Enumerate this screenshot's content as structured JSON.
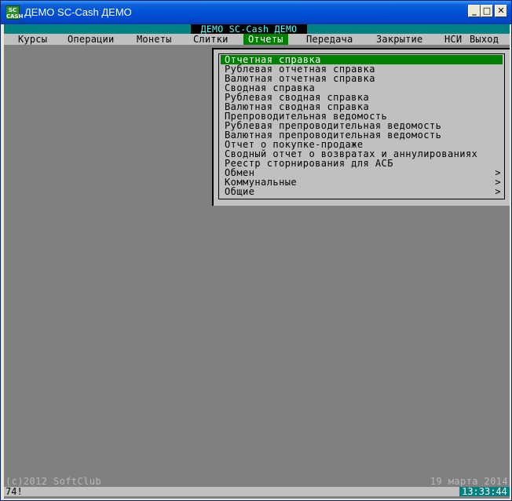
{
  "window": {
    "title": "ДЕМО SC-Cash ДЕМО",
    "icon_text": "SC CASH",
    "controls": {
      "minimize": "_",
      "maximize": "□",
      "close": "✕"
    }
  },
  "terminal": {
    "title": "ДЕМО SC-Cash ДЕМО",
    "menu": [
      {
        "label": "Курсы"
      },
      {
        "label": "Операции"
      },
      {
        "label": "Монеты"
      },
      {
        "label": "Слитки"
      },
      {
        "label": "Отчеты",
        "active": true
      },
      {
        "label": "Передача"
      },
      {
        "label": "Закрытие"
      },
      {
        "label": "НСИ"
      },
      {
        "label": "Выход"
      }
    ],
    "dropdown": [
      {
        "label": "Отчетная справка",
        "selected": true
      },
      {
        "label": "Рублевая отчетная справка"
      },
      {
        "label": "Валютная отчетная справка"
      },
      {
        "label": "Сводная справка"
      },
      {
        "label": "Рублевая сводная справка"
      },
      {
        "label": "Валютная сводная справка"
      },
      {
        "label": "Препроводительная ведомость"
      },
      {
        "label": "Рублевая препроводительная ведомость"
      },
      {
        "label": "Валютная препроводительная ведомость"
      },
      {
        "label": "Отчет о покупке-продаже"
      },
      {
        "label": "Сводный отчет о возвратах и аннулированиях"
      },
      {
        "label": "Реестр сторнирования для АСБ"
      },
      {
        "label": "Обмен",
        "arrow": ">"
      },
      {
        "label": "Коммунальные",
        "arrow": ">"
      },
      {
        "label": "Общие",
        "arrow": ">"
      }
    ],
    "footer": {
      "copyright": "(c)2012 SoftClub",
      "date": "19 марта 2014"
    },
    "status": {
      "left": "74!",
      "time": "13:33:44"
    }
  },
  "colors": {
    "title_gradient": "#0050d8",
    "terminal_bg": "#808080",
    "menubar_bg": "#c0c0c0",
    "highlight": "#008000",
    "teal": "#008080",
    "title_text": "#55ffff"
  }
}
